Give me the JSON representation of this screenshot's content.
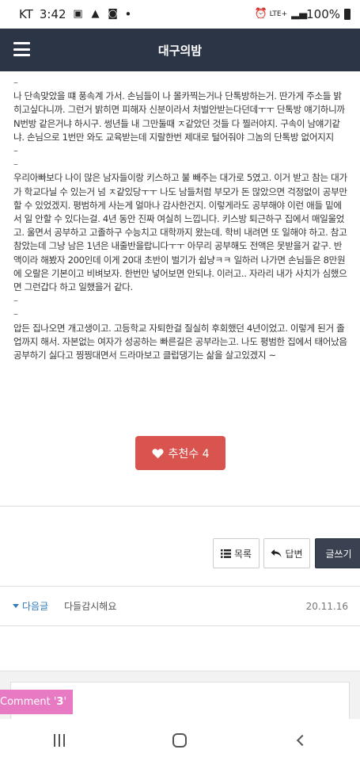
{
  "status": {
    "carrier": "KT",
    "time": "3:42",
    "dot": "•",
    "network": "LTE+",
    "battery": "100%"
  },
  "header": {
    "title": "대구의밤"
  },
  "post": {
    "lines": [
      "–",
      "나 단속맞았을 떄 풍속계 가서. 손님들이 나 몰카찍는거나 단톡방하는거. 딴가게 주소들 밝히고싶다니까. 그런거 밝히면 피해자 신분이라서 처벌안받는다던데ㅜㅜ 단톡방 얘기하니까 N번방 같은거냐 하시구. 썽년들 내 그만둘때 ㅈ같았던 것들 다 찔러야지. 구속이 남얘기같냐. 손님으로 1번만 와도 교육받는데 지랄한번 제대로 털어줘야 그놈의 단톡방 없어지지",
      "–",
      "–",
      "우리아빠보다 나이 많은 남자들이랑 키스하고 불 빼주는 대가로 5였고. 이거 받고 참는 대가가 학교다닐 수 있는거 넘 ㅈ같있당ㅜㅜ 나도 남들처럼 부모가 돈 많았으면 걱정없이 공부만 할 수 있었겠지. 평범하게 사는게 얼마나 감사한건지. 이렇게라도 공부해야 이런 애들 밑에서 일 안할 수 있다는걸. 4년 동안 진짜 여실히 느낍니다. 키스방 퇴근하구 집에서 매일울었고. 울면서 공부하고 고졸하구 수능치고 대학까지 왔는데. 학비 내려면 또 일해야 하고. 참고 참았는데 그냥 남은 1년은 내줄반을랍니다ㅜㅜ 아무리 공부해도 전액은 못받을거 같구. 반액이라 해봤자 200인데 이게 20대 초반이 벌기가 쉽냥ㅋㅋ 일하러 나가면 손님들은 8만원에 오랄은 기본이고 비벼보자. 한번만 넣어보면 안되냐. 이러고.. 자라리 내가 사치가 심했으면 그런갑다 하고 일했을거 같다.",
      "–",
      "–",
      "압든 집나오면 개고생이고. 고등학교 자퇴한걸 질실히 후회했던 4년이었고. 이렇게 된거 졸업까지 해서. 자본없는 여자가 성공하는 빠른길은 공부라는고. 나도 평범한 집에서 태어났음 공부하기 싫다고 찡찡대면서 드라마보고 클럽댕기는 삶을 살고있겠지 ~"
    ]
  },
  "like_button": {
    "label": "추천수 4"
  },
  "actions": {
    "list_label": "목록",
    "reply_label": "답변",
    "write_label": "글쓰기"
  },
  "next_post": {
    "link_label": "다음글",
    "title": "다들감시해요",
    "date": "20.11.16"
  },
  "comment": {
    "tag_prefix": "Comment '",
    "tag_count": "3",
    "tag_suffix": "'",
    "tag_color": "#e879c3"
  },
  "colors": {
    "header_bg": "#2c3545",
    "like_bg": "#d9534f",
    "link": "#337ab7"
  }
}
